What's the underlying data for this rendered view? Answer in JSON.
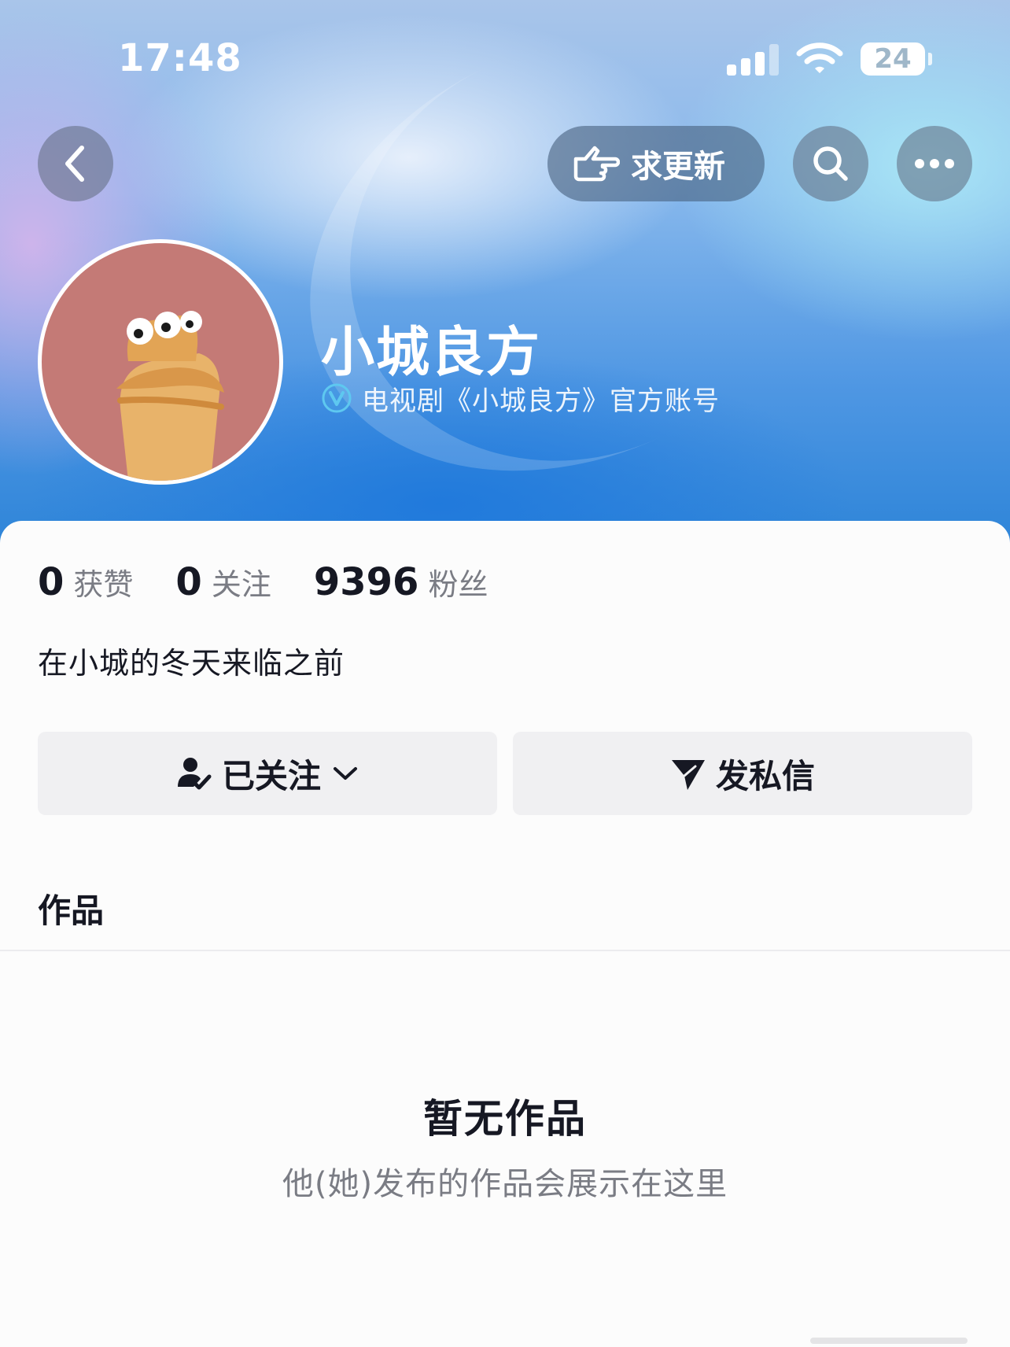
{
  "status_bar": {
    "time": "17:48",
    "battery_level": "24",
    "signal_icon": "cellular-signal-icon",
    "wifi_icon": "wifi-icon"
  },
  "nav": {
    "back_icon": "chevron-left-icon",
    "update_label": "求更新",
    "update_icon": "pointing-hand-icon",
    "search_icon": "search-icon",
    "more_icon": "more-dots-icon"
  },
  "profile": {
    "name": "小城良方",
    "verification": "电视剧《小城良方》官方账号",
    "verified_icon": "verified-v-icon",
    "bio": "在小城的冬天来临之前"
  },
  "stats": [
    {
      "value": "0",
      "label": "获赞"
    },
    {
      "value": "0",
      "label": "关注"
    },
    {
      "value": "9396",
      "label": "粉丝"
    }
  ],
  "actions": {
    "followed_label": "已关注",
    "followed_icon": "user-check-icon",
    "dropdown_icon": "chevron-down-icon",
    "message_label": "发私信",
    "message_icon": "paper-plane-icon"
  },
  "works": {
    "tab_label": "作品",
    "empty_title": "暂无作品",
    "empty_subtitle": "他(她)发布的作品会展示在这里"
  },
  "colors": {
    "hero_blue": "#4f97e3",
    "avatar_bg": "#c47a76",
    "text_primary": "#161823",
    "text_secondary": "#7a7c84",
    "button_bg": "#f0f0f2"
  }
}
